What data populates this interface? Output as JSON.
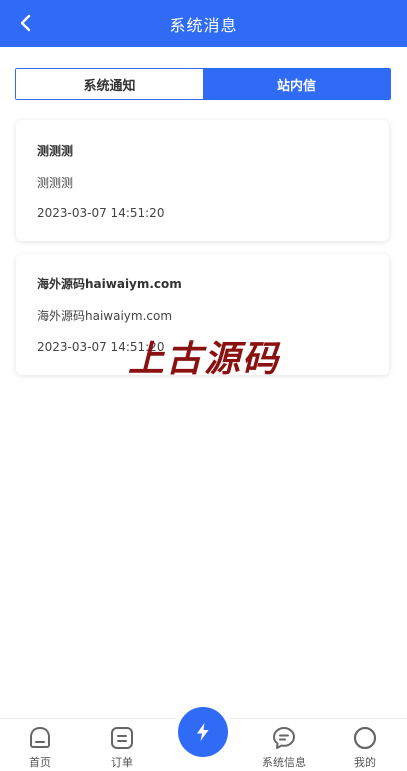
{
  "header": {
    "title": "系统消息"
  },
  "tabs": [
    {
      "label": "系统通知",
      "active": false
    },
    {
      "label": "站内信",
      "active": true
    }
  ],
  "messages": [
    {
      "title": "测测测",
      "body": "测测测",
      "time": "2023-03-07 14:51:20"
    },
    {
      "title": "海外源码haiwaiym.com",
      "body": "海外源码haiwaiym.com",
      "time": "2023-03-07 14:51:20"
    }
  ],
  "watermark": "上古源码",
  "tabbar": {
    "items": [
      {
        "label": "首页",
        "icon": "home-icon"
      },
      {
        "label": "订单",
        "icon": "order-icon"
      },
      {
        "label": "",
        "icon": "lightning-icon"
      },
      {
        "label": "系统信息",
        "icon": "chat-icon"
      },
      {
        "label": "我的",
        "icon": "profile-icon"
      }
    ]
  },
  "colors": {
    "primary": "#2f6bf5",
    "watermark": "#8b1010"
  }
}
